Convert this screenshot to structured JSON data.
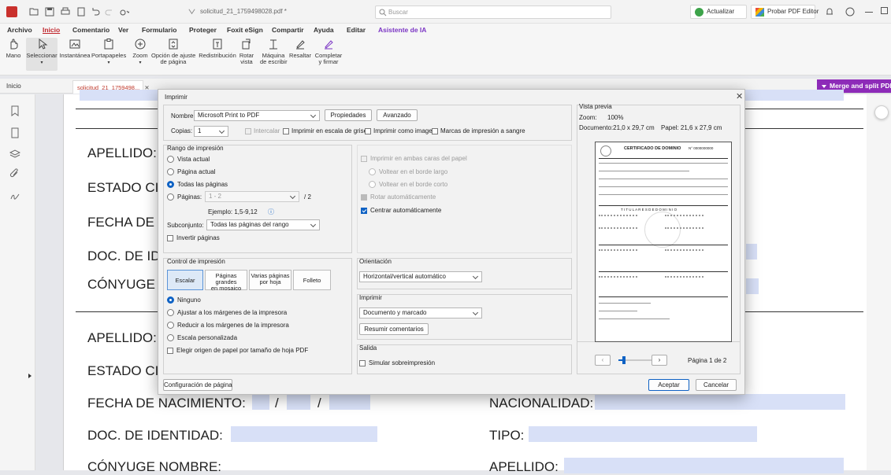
{
  "titlebar": {
    "doc_title": "solicitud_21_1759498028.pdf *",
    "search_placeholder": "Buscar",
    "update_label": "Actualizar",
    "trial_label": "Probar PDF Editor"
  },
  "menu": [
    "Archivo",
    "Inicio",
    "Comentario",
    "Ver",
    "Formulario",
    "Proteger",
    "Foxit eSign",
    "Compartir",
    "Ayuda",
    "Editar",
    "Asistente de IA"
  ],
  "ribbon": {
    "tools": [
      {
        "l1": "Mano",
        "l2": ""
      },
      {
        "l1": "Seleccionar",
        "l2": ""
      },
      {
        "l1": "Instantánea",
        "l2": ""
      },
      {
        "l1": "Portapapeles",
        "l2": ""
      },
      {
        "l1": "Zoom",
        "l2": ""
      },
      {
        "l1": "Opción de ajuste",
        "l2": "de página"
      },
      {
        "l1": "Redistribución",
        "l2": ""
      },
      {
        "l1": "Rotar",
        "l2": "vista"
      },
      {
        "l1": "Máquina",
        "l2": "de escribir"
      },
      {
        "l1": "Resaltar",
        "l2": ""
      },
      {
        "l1": "Completar",
        "l2": "y firmar"
      }
    ]
  },
  "tabs": {
    "home": "Inicio",
    "doc": "solicitud_21_1759498..."
  },
  "merge_label": "Merge and split PDFs",
  "page": {
    "upper_fields": [
      "APELLIDO: A",
      "ESTADO CIV",
      "FECHA DE N",
      "DOC. DE IDE",
      "CÓNYUGE N"
    ],
    "lower_fields": [
      "APELLIDO:",
      "ESTADO CIV",
      "FECHA DE NACIMIENTO:",
      "DOC. DE IDENTIDAD:",
      "CÓNYUGE NOMBRE:"
    ],
    "right_fields": [
      "NACIONALIDAD:",
      "TIPO:",
      "APELLIDO:"
    ],
    "date_sep": "/"
  },
  "dialog": {
    "title": "Imprimir",
    "name_label": "Nombre:",
    "printer": "Microsoft Print to PDF",
    "properties": "Propiedades",
    "advanced": "Avanzado",
    "copies_label": "Copias:",
    "copies": "1",
    "opt_collate": "Intercalar",
    "opt_grayscale": "Imprimir en escala de grises",
    "opt_as_image": "Imprimir como imagen",
    "opt_bleed": "Marcas de impresión a sangre",
    "range_title": "Rango de impresión",
    "range_current_view": "Vista actual",
    "range_current_page": "Página actual",
    "range_all": "Todas las páginas",
    "range_pages": "Páginas:",
    "pages_value": "1 - 2",
    "pages_total": "/ 2",
    "example": "Ejemplo: 1,5-9,12",
    "subset_label": "Subconjunto:",
    "subset_value": "Todas las páginas del rango",
    "reverse": "Invertir páginas",
    "duplex": "Imprimir en ambas caras del papel",
    "flip_long": "Voltear en el borde largo",
    "flip_short": "Voltear en el borde corto",
    "auto_rotate": "Rotar automáticamente",
    "auto_center": "Centrar automáticamente",
    "control_title": "Control de impresión",
    "seg_scale": "Escalar",
    "seg_tile_1": "Páginas grandes",
    "seg_tile_2": "en mosaico",
    "seg_multi_1": "Varias páginas",
    "seg_multi_2": "por hoja",
    "seg_booklet": "Folleto",
    "scale_none": "Ninguno",
    "scale_fit": "Ajustar a los márgenes de la impresora",
    "scale_reduce": "Reducir a los márgenes de la impresora",
    "scale_custom": "Escala personalizada",
    "paper_source": "Elegir origen de papel por tamaño de hoja PDF",
    "orient_title": "Orientación",
    "orient_value": "Horizontal/vertical automático",
    "print_title": "Imprimir",
    "print_value": "Documento y marcado",
    "summarize": "Resumir comentarios",
    "output_title": "Salida",
    "overprint": "Simular sobreimpresión",
    "page_setup": "Configuración de página",
    "accept": "Aceptar",
    "cancel": "Cancelar",
    "preview": {
      "title": "Vista previa",
      "zoom_label": "Zoom:",
      "zoom": "100%",
      "doc_size": "Documento:21,0 x 29,7 cm",
      "paper_size": "Papel: 21,6 x 27,9 cm",
      "page_counter": "Página 1 de 2",
      "cert_title": "CERTIFICADO DE DOMINIO",
      "cert_no": "N° 0000000000",
      "owners": "T I T U L A R E S   D E   D O M I N I O",
      "progress": 0.1
    }
  }
}
